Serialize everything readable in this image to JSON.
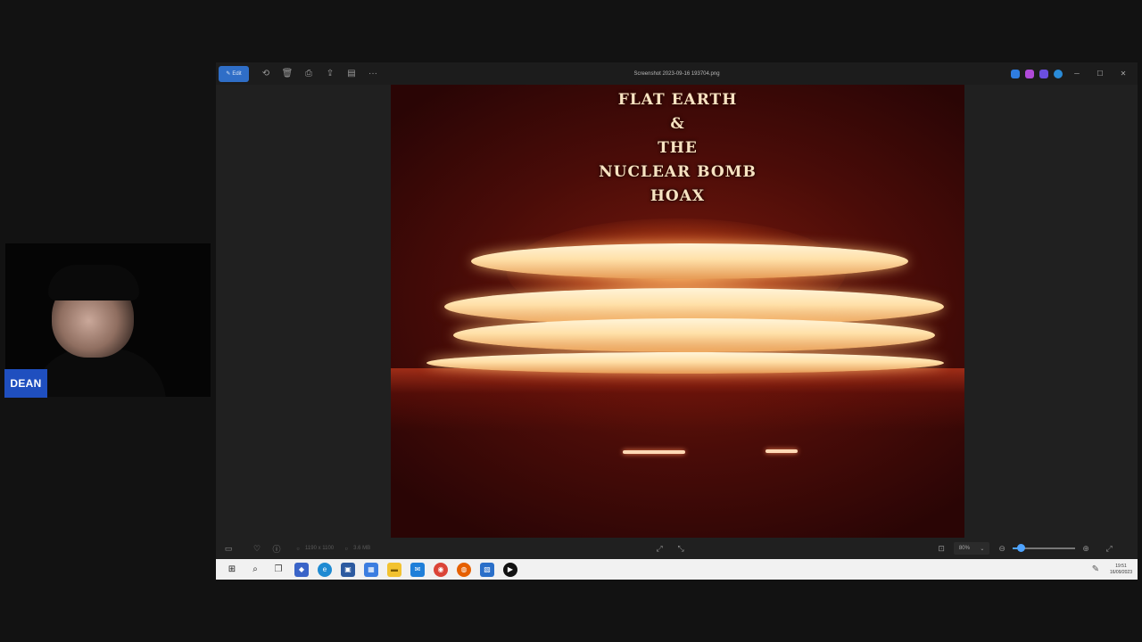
{
  "webcam": {
    "name_tag": "DEAN"
  },
  "window": {
    "title": "Screenshot 2023-09-16 193704.png",
    "edit_label": "Edit"
  },
  "poster": {
    "lines": [
      "FLAT EARTH",
      "&",
      "THE",
      "NUCLEAR BOMB",
      "HOAX"
    ]
  },
  "bottom_bar": {
    "dimensions": "1190 x 1100",
    "file_size": "3.6 MB",
    "zoom": "80%"
  },
  "zoom_slider": {
    "level": 0.12
  },
  "taskbar": {
    "time": "19:51",
    "date": "16/09/2023"
  },
  "colors": {
    "edit_accent": "#2f6ec7",
    "name_tag": "#1f4fbf"
  }
}
